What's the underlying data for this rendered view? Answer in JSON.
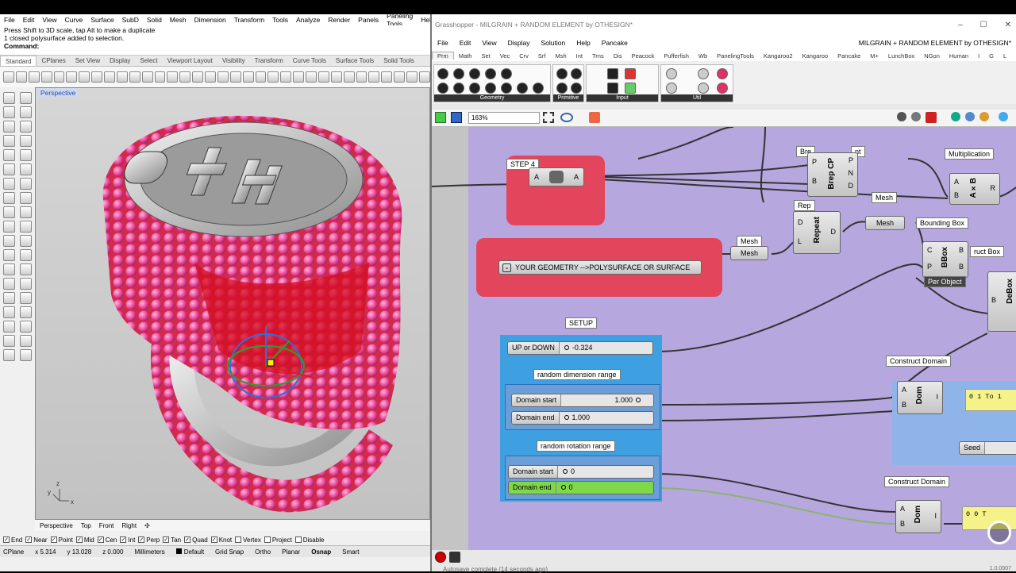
{
  "rhino": {
    "menu": [
      "File",
      "Edit",
      "View",
      "Curve",
      "Surface",
      "SubD",
      "Solid",
      "Mesh",
      "Dimension",
      "Transform",
      "Tools",
      "Analyze",
      "Render",
      "Panels",
      "Paneling Tools",
      "Help"
    ],
    "cmd_line1": "Press Shift to 3D scale, tap Alt to make a duplicate",
    "cmd_line2": "1 closed polysurface added to selection.",
    "cmd_prompt": "Command:",
    "tabs": [
      "Standard",
      "CPlanes",
      "Set View",
      "Display",
      "Select",
      "Viewport Layout",
      "Visibility",
      "Transform",
      "Curve Tools",
      "Surface Tools",
      "Solid Tools"
    ],
    "viewport_label": "Perspective",
    "view_tabs": [
      "Perspective",
      "Top",
      "Front",
      "Right"
    ],
    "osnaps": [
      {
        "label": "End",
        "on": true
      },
      {
        "label": "Near",
        "on": true
      },
      {
        "label": "Point",
        "on": true
      },
      {
        "label": "Mid",
        "on": true
      },
      {
        "label": "Cen",
        "on": true
      },
      {
        "label": "Int",
        "on": true
      },
      {
        "label": "Perp",
        "on": true
      },
      {
        "label": "Tan",
        "on": true
      },
      {
        "label": "Quad",
        "on": true
      },
      {
        "label": "Knot",
        "on": true
      },
      {
        "label": "Vertex",
        "on": false
      },
      {
        "label": "Project",
        "on": false
      },
      {
        "label": "Disable",
        "on": false
      }
    ],
    "status": {
      "cplane": "CPlane",
      "x": "x 5.314",
      "y": "y 13.028",
      "z": "z 0.000",
      "units": "Millimeters",
      "layer": "Default",
      "grid_snap": "Grid Snap",
      "ortho": "Ortho",
      "planar": "Planar",
      "osnap": "Osnap",
      "smart": "Smart"
    },
    "axis_x": "x",
    "axis_y": "y",
    "axis_z": "z"
  },
  "gh": {
    "title": "Grasshopper - MILGRAIN + RANDOM ELEMENT by OTHESIGN*",
    "menu": [
      "File",
      "Edit",
      "View",
      "Display",
      "Solution",
      "Help",
      "Pancake"
    ],
    "doc_title": "MILGRAIN + RANDOM ELEMENT by OTHESIGN*",
    "tabs": [
      "Prm",
      "Math",
      "Set",
      "Vec",
      "Crv",
      "Srf",
      "Msh",
      "Int",
      "Trns",
      "Dis",
      "Peacock",
      "Pufferfish",
      "Wb",
      "PanelingTools",
      "Kangaroo2",
      "Kangaroo",
      "Pancake",
      "M+",
      "LunchBox",
      "NGon",
      "Human",
      "I",
      "G",
      "L"
    ],
    "ribbon_groups": [
      "Geometry",
      "Primitive",
      "Input",
      "Util"
    ],
    "zoom": "163%",
    "status": "Autosave complete (14 seconds ago)",
    "version": "1.0.0007",
    "step4": "STEP 4",
    "geom_input": "YOUR GEOMETRY -->POLYSURFACE OR SURFACE",
    "setup": "SETUP",
    "up_down": {
      "name": "UP or DOWN",
      "value": "-0.324"
    },
    "rdr": "random dimension range",
    "dim_start": {
      "name": "Domain start",
      "value": "1.000"
    },
    "dim_end": {
      "name": "Domain end",
      "value": "1.000"
    },
    "rrr": "random rotation range",
    "rot_start": {
      "name": "Domain start",
      "value": "0"
    },
    "rot_end": {
      "name": "Domain end",
      "value": "0"
    },
    "construct_domain": "Construct Domain",
    "panel1": "0 1 To 1",
    "panel2": "0 0 T",
    "seed": "Seed",
    "mesh": "Mesh",
    "mesh_lbl": "Mesh",
    "mesh2": "Mesh",
    "mesh2_lbl": "Mesh",
    "bounding_box": "Bounding Box",
    "per_object": "Per Object",
    "multiplication": "Multiplication",
    "construct_box": "ruct Box",
    "brep_cp": "Brep CP",
    "repeat": "Repeat",
    "bbox": "BBox",
    "axb": "A×B",
    "dom": "Dom",
    "debox": "DeBox",
    "brep_lbl": "Bre",
    "brep_lbl_r": "nt",
    "rep_lbl": "Rep",
    "pin_a": "A",
    "pin_b": "B",
    "pin_c": "C",
    "pin_d": "D",
    "pin_l": "L",
    "pin_n": "N",
    "pin_p": "P",
    "pin_r": "R",
    "pin_i": "I"
  }
}
